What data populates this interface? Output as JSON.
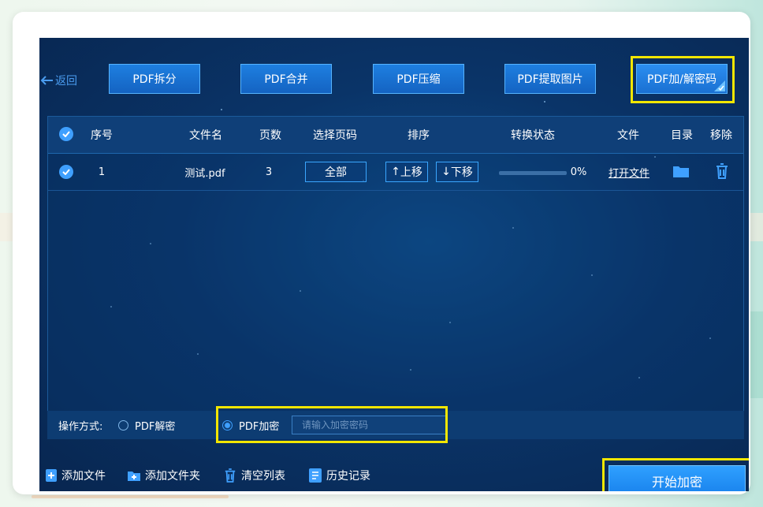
{
  "top": {
    "back_label": "返回",
    "buttons": [
      "PDF拆分",
      "PDF合并",
      "PDF压缩",
      "PDF提取图片",
      "PDF加/解密码"
    ]
  },
  "table": {
    "headers": [
      "序号",
      "文件名",
      "页数",
      "选择页码",
      "排序",
      "转换状态",
      "文件",
      "目录",
      "移除"
    ],
    "rows": [
      {
        "index": "1",
        "filename": "测试.pdf",
        "pages": "3",
        "page_select": "全部",
        "move_up": "上移",
        "move_down": "下移",
        "progress_percent": 0,
        "progress_text": "0%",
        "open_file": "打开文件"
      }
    ]
  },
  "options": {
    "label": "操作方式:",
    "decrypt": "PDF解密",
    "encrypt": "PDF加密",
    "selected": "encrypt",
    "password_placeholder": "请输入加密密码"
  },
  "bottom": {
    "add_file": "添加文件",
    "add_folder": "添加文件夹",
    "clear_list": "清空列表",
    "history": "历史记录",
    "start": "开始加密"
  },
  "colors": {
    "accent": "#3fa0ff",
    "highlight": "#f2e600",
    "app_bg": "#0a3468"
  }
}
